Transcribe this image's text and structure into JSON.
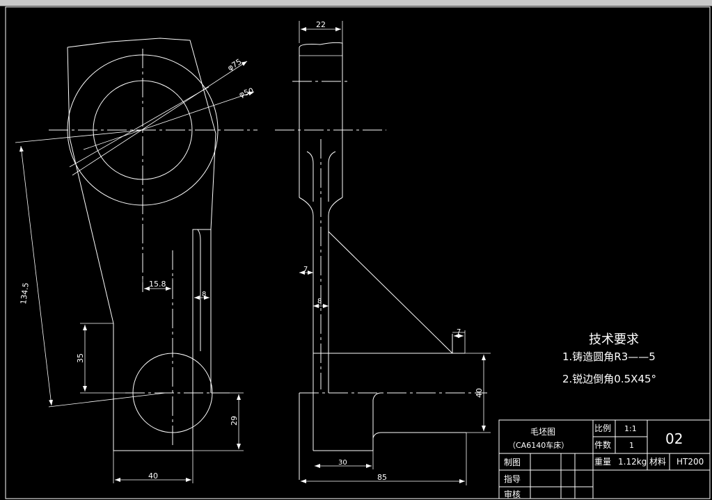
{
  "drawing": {
    "dimensions": {
      "width_22": "22",
      "dia_75": "φ75",
      "dia_50": "φ50",
      "len_134_5": "134.5",
      "h_35": "35",
      "w_15_8": "15.8",
      "w_8_left": "8",
      "w_40": "40",
      "h_29": "29",
      "w_7_side": "7",
      "w_8_side": "8",
      "w_7_right": "7",
      "h_40": "40",
      "w_30": "30",
      "w_85": "85"
    },
    "tech_requirements": {
      "title": "技术要求",
      "items": [
        "1.铸造圆角R3——5",
        "2.锐边倒角0.5X45°"
      ]
    }
  },
  "title_block": {
    "name": "毛坯图",
    "machine": "（CA6140车床）",
    "scale_label": "比例",
    "scale_value": "1:1",
    "qty_label": "件数",
    "qty_value": "1",
    "drawing_no": "02",
    "weight_label": "重量",
    "weight_value": "1.12kg",
    "material_label": "材料",
    "material_value": "HT200",
    "drafter_label": "制图",
    "instructor_label": "指导",
    "reviewer_label": "审核"
  },
  "colors": {
    "background": "#000000",
    "lines": "#ffffff",
    "window_bar": "#c8c8c8"
  }
}
